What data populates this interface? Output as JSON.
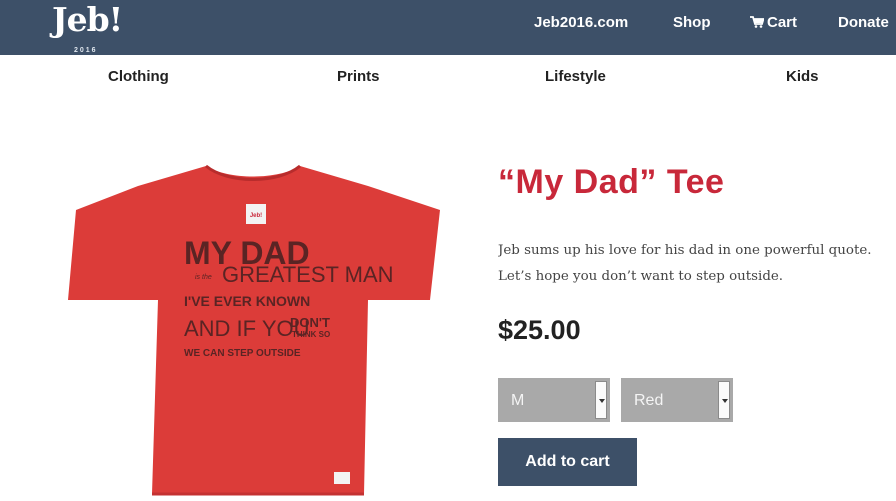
{
  "header": {
    "logo_text": "Jeb!",
    "logo_year": "2016",
    "nav": {
      "site": "Jeb2016.com",
      "shop": "Shop",
      "cart": "Cart",
      "donate": "Donate"
    }
  },
  "categories": [
    "Clothing",
    "Prints",
    "Lifestyle",
    "Kids"
  ],
  "product": {
    "title": "“My Dad” Tee",
    "description_lines": [
      "Jeb sums up his love for his dad in one powerful quote.",
      "Let’s hope you don’t want to step outside."
    ],
    "price": "$25.00",
    "size_select": "M",
    "color_select": "Red",
    "add_to_cart_label": "Add to cart"
  },
  "shirt_print": {
    "line1": "MY DAD",
    "small_word": "is the",
    "line2": "GREATEST MAN",
    "line3": "I'VE EVER KNOWN",
    "line4a": "AND IF YOU",
    "line4b": "DON'T",
    "line4c": "THINK SO",
    "line5": "WE CAN STEP OUTSIDE",
    "tag_text": "Jeb!"
  },
  "colors": {
    "header_bg": "#3d5068",
    "title_red": "#c8283a",
    "shirt_red": "#dc3c39",
    "select_gray": "#a9a9a9"
  }
}
